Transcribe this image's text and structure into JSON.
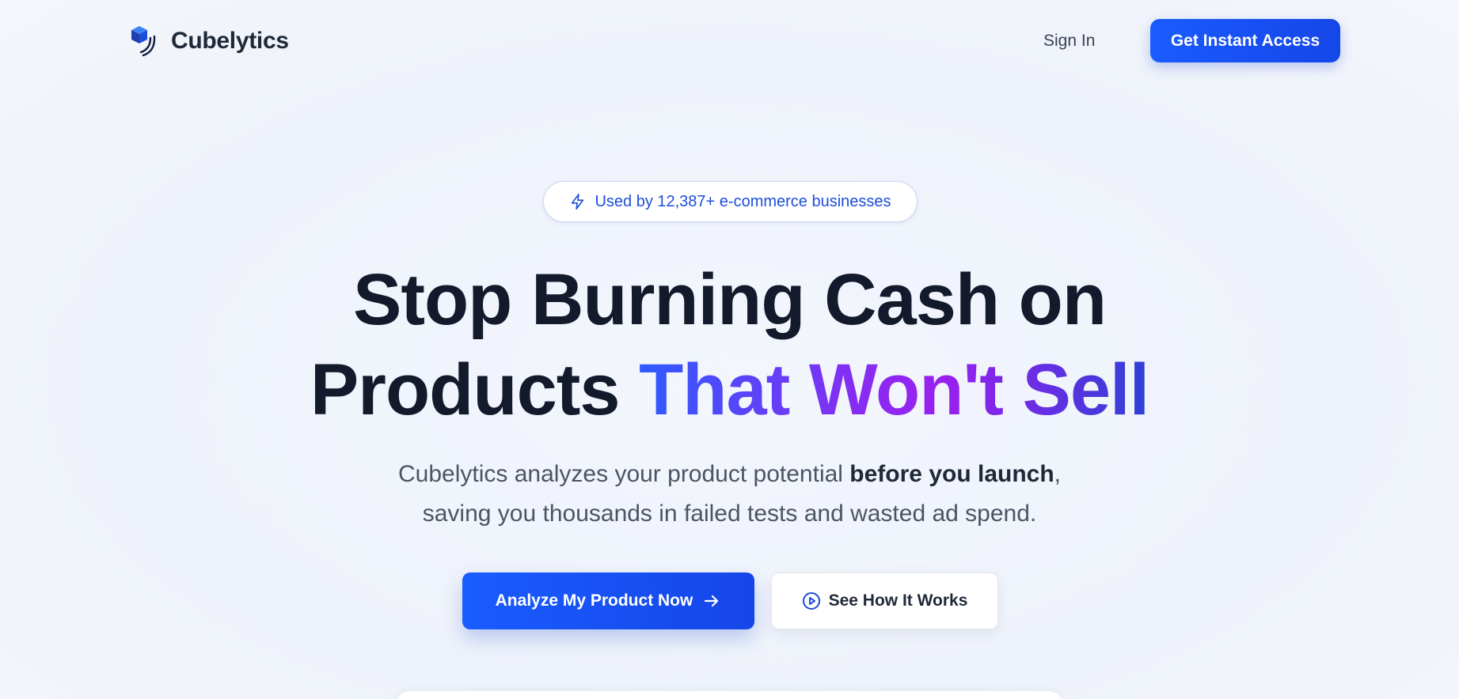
{
  "nav": {
    "brand": "Cubelytics",
    "logo_icon": "cube-logo-icon",
    "sign_in_label": "Sign In",
    "cta_label": "Get Instant Access"
  },
  "hero": {
    "badge": {
      "icon": "lightning-bolt-icon",
      "text": "Used by 12,387+ e-commerce businesses"
    },
    "headline": {
      "line1": "Stop Burning Cash on",
      "line2_plain": "Products ",
      "line2_highlight": "That Won't Sell"
    },
    "subtext": {
      "part1": "Cubelytics analyzes your product potential ",
      "bold": "before you launch",
      "part2": ",",
      "line2": "saving you thousands in failed tests and wasted ad spend."
    },
    "primary_button": {
      "label": "Analyze My Product Now",
      "icon": "arrow-right-icon"
    },
    "secondary_button": {
      "label": "See How It Works",
      "icon": "play-circle-icon"
    }
  },
  "colors": {
    "accent": "#1a5cff",
    "headline_text": "#131a2b",
    "gradient_start": "#2f5bff",
    "gradient_mid": "#9a1ff0",
    "gradient_end": "#2f40d6"
  }
}
